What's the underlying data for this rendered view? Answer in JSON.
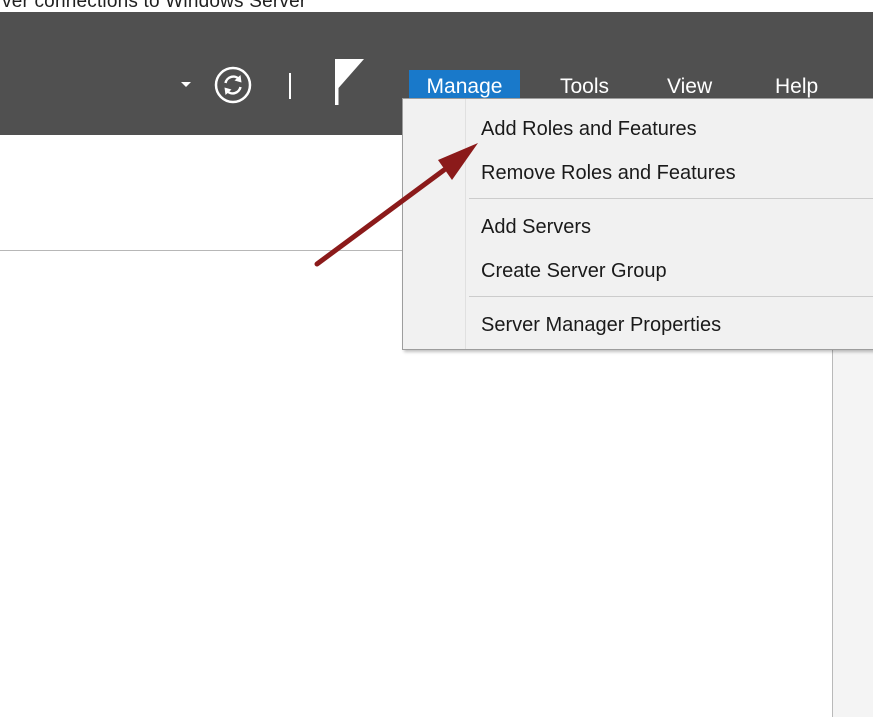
{
  "top_strip_text": "ver connections to Windows Server",
  "toolbar": {
    "dropdown_icon": "caret-down-icon",
    "refresh_icon": "refresh-icon",
    "notifications_icon": "flag-icon"
  },
  "menubar": {
    "items": [
      {
        "label": "Manage",
        "active": true
      },
      {
        "label": "Tools"
      },
      {
        "label": "View"
      },
      {
        "label": "Help"
      }
    ]
  },
  "manage_menu": {
    "items": [
      {
        "label": "Add Roles and Features"
      },
      {
        "label": "Remove Roles and Features"
      },
      {
        "label": "Add Servers"
      },
      {
        "label": "Create Server Group"
      },
      {
        "label": "Server Manager Properties"
      }
    ]
  },
  "colors": {
    "titlebar": "#505050",
    "active_menu": "#1979ca",
    "arrow": "#8b1a1a",
    "menu_bg": "#f1f1f1"
  }
}
